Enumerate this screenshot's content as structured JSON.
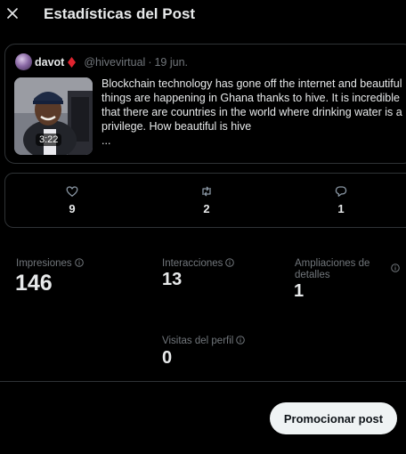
{
  "header": {
    "title": "Estadísticas del Post",
    "close_icon": "close-icon"
  },
  "post": {
    "author_name": "davot",
    "badge_icon": "red-diamond-icon",
    "badge_color": "#e0242f",
    "handle": "@hivevirtual",
    "separator": "·",
    "date": "19 jun.",
    "text": "Blockchain technology has gone off the internet and beautiful things are happening in Ghana thanks to hive. It is incredible that there are countries in the world where drinking water is a privilege. How beautiful is hive",
    "ellipsis": "...",
    "video_duration": "3:22"
  },
  "engagement": {
    "likes": {
      "icon": "heart-icon",
      "count": "9"
    },
    "reposts": {
      "icon": "repost-icon",
      "count": "2"
    },
    "replies": {
      "icon": "reply-icon",
      "count": "1"
    }
  },
  "stats": {
    "impressions": {
      "label": "Impresiones",
      "value": "146"
    },
    "interactions": {
      "label": "Interacciones",
      "value": "13"
    },
    "detail_expands": {
      "label": "Ampliaciones de detalles",
      "value": "1"
    },
    "profile_visits": {
      "label": "Visitas del perfil",
      "value": "0"
    }
  },
  "actions": {
    "promote_label": "Promocionar post"
  },
  "colors": {
    "background": "#000000",
    "border": "#2f3336",
    "muted": "#71767b",
    "text": "#e7e9ea",
    "button_bg": "#eff3f4"
  }
}
